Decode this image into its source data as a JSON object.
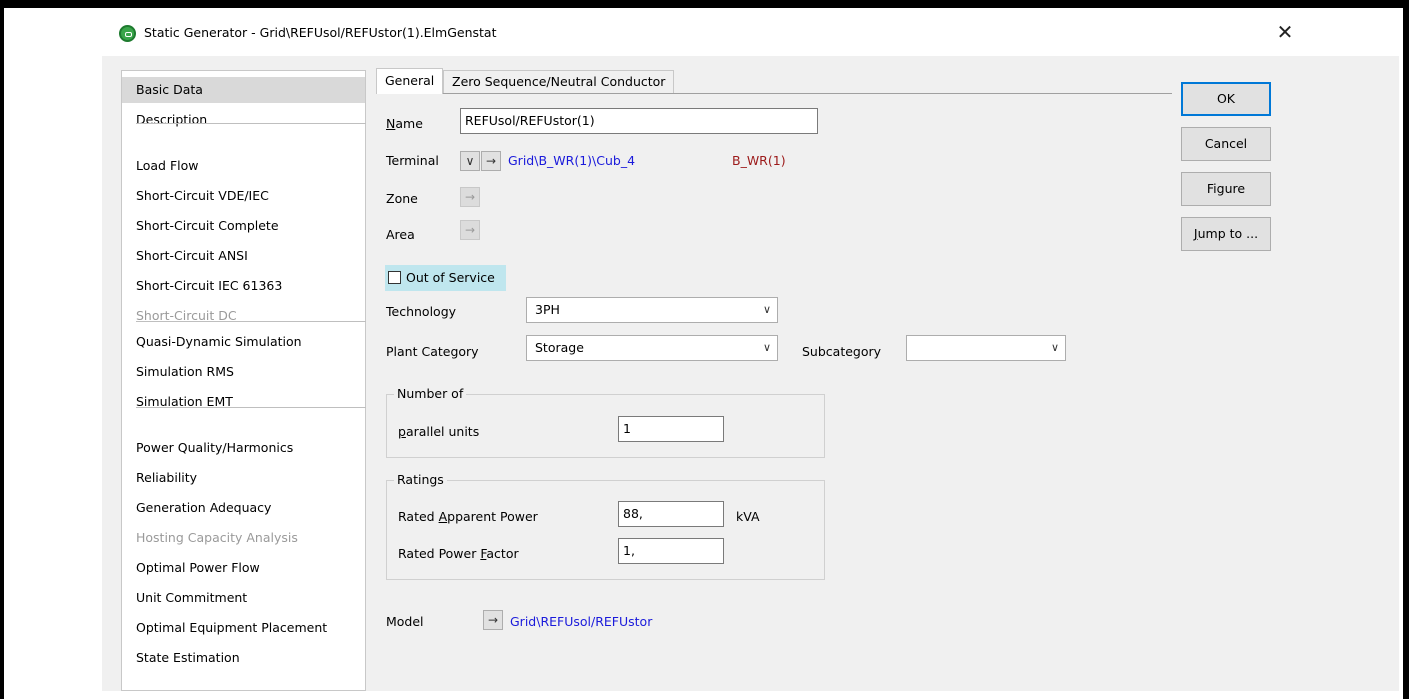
{
  "window": {
    "title": "Static Generator - Grid\\REFUsol/REFUstor(1).ElmGenstat",
    "close_glyph": "✕"
  },
  "nav": {
    "items": [
      {
        "label": "Basic Data",
        "state": "selected"
      },
      {
        "label": "Description",
        "state": "normal"
      },
      {
        "label": "Load Flow",
        "state": "normal"
      },
      {
        "label": "Short-Circuit VDE/IEC",
        "state": "normal"
      },
      {
        "label": "Short-Circuit Complete",
        "state": "normal"
      },
      {
        "label": "Short-Circuit ANSI",
        "state": "normal"
      },
      {
        "label": "Short-Circuit IEC 61363",
        "state": "normal"
      },
      {
        "label": "Short-Circuit DC",
        "state": "disabled"
      },
      {
        "label": "Quasi-Dynamic Simulation",
        "state": "normal"
      },
      {
        "label": "Simulation RMS",
        "state": "normal"
      },
      {
        "label": "Simulation EMT",
        "state": "normal"
      },
      {
        "label": "Power Quality/Harmonics",
        "state": "normal"
      },
      {
        "label": "Reliability",
        "state": "normal"
      },
      {
        "label": "Generation Adequacy",
        "state": "normal"
      },
      {
        "label": "Hosting Capacity Analysis",
        "state": "disabled"
      },
      {
        "label": "Optimal Power Flow",
        "state": "normal"
      },
      {
        "label": "Unit Commitment",
        "state": "normal"
      },
      {
        "label": "Optimal Equipment Placement",
        "state": "normal"
      },
      {
        "label": "State Estimation",
        "state": "normal"
      }
    ]
  },
  "tabs": {
    "general": "General",
    "zero_sequence": "Zero Sequence/Neutral Conductor"
  },
  "form": {
    "name_label_mn": "N",
    "name_label_rest": "ame",
    "name_value": "REFUsol/REFUstor(1)",
    "terminal_label": "Terminal",
    "terminal_link": "Grid\\B_WR(1)\\Cub_4",
    "terminal_bus": "B_WR(1)",
    "zone_label": "Zone",
    "area_label": "Area",
    "out_of_service": "Out of Service",
    "technology_label": "Technology",
    "technology_value": "3PH",
    "plant_category_label": "Plant Category",
    "plant_category_value": "Storage",
    "subcategory_label": "Subcategory",
    "subcategory_value": "",
    "number_of_title": "Number of",
    "parallel_units_mn": "p",
    "parallel_units_rest": "arallel units",
    "parallel_units_value": "1",
    "ratings_title": "Ratings",
    "rated_apparent_pre": "Rated ",
    "rated_apparent_mn": "A",
    "rated_apparent_rest": "pparent Power",
    "rated_apparent_value": "88,",
    "rated_apparent_unit": "kVA",
    "rated_pf_pre": "Rated Power ",
    "rated_pf_mn": "F",
    "rated_pf_rest": "actor",
    "rated_pf_value": "1,",
    "model_label": "Model",
    "model_link": "Grid\\REFUsol/REFUstor"
  },
  "glyphs": {
    "arrow": "→",
    "chevron": "∨",
    "combo_chevron": "∨"
  },
  "buttons": {
    "ok": "OK",
    "cancel": "Cancel",
    "figure": "Figure",
    "jump_mn": "J",
    "jump_rest": "ump to ..."
  }
}
